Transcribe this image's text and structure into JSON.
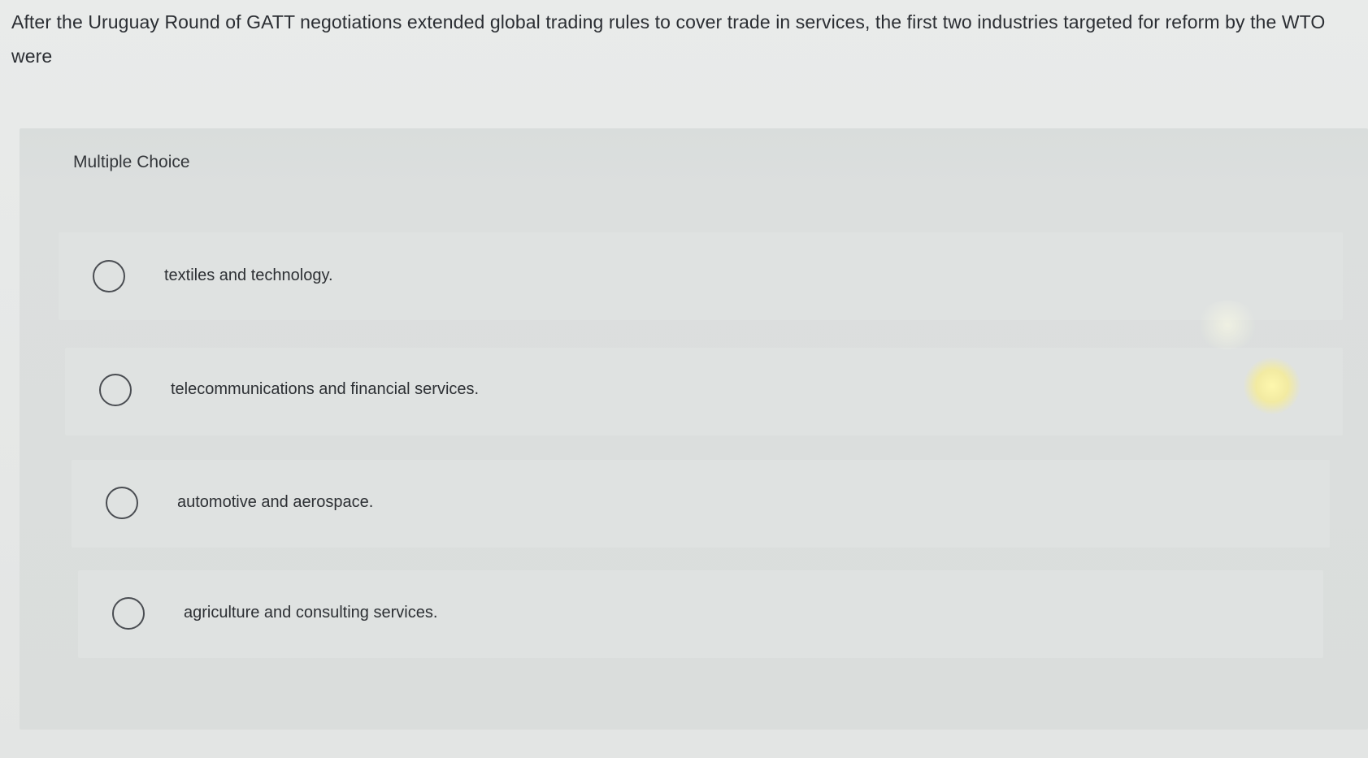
{
  "question": {
    "text": "After the Uruguay Round of GATT negotiations extended global trading rules to cover trade in services, the first two industries targeted for reform by the WTO were"
  },
  "panel": {
    "label": "Multiple Choice"
  },
  "options": [
    {
      "label": "textiles and technology."
    },
    {
      "label": "telecommunications and financial services."
    },
    {
      "label": "automotive and aerospace."
    },
    {
      "label": "agriculture and consulting services."
    }
  ]
}
